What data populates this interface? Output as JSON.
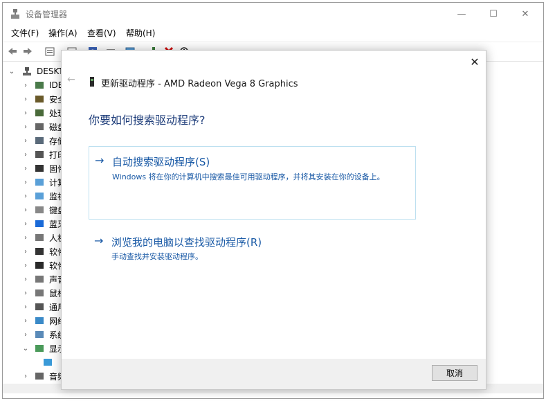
{
  "window": {
    "title": "设备管理器",
    "controls": {
      "minimize": "—",
      "maximize": "☐",
      "close": "✕"
    }
  },
  "menu": [
    "文件(F)",
    "操作(A)",
    "查看(V)",
    "帮助(H)"
  ],
  "toolbar": [
    "back-icon",
    "forward-icon",
    "properties-icon",
    "view-icon",
    "help-icon",
    "toolbar-icon",
    "monitor-icon",
    "scan-icon",
    "uninstall-icon",
    "disable-icon"
  ],
  "tree": {
    "root": "DESKT",
    "items": [
      {
        "label": "IDE",
        "icon": "ide-icon"
      },
      {
        "label": "安全",
        "icon": "security-icon"
      },
      {
        "label": "处理",
        "icon": "processor-icon"
      },
      {
        "label": "磁盘",
        "icon": "disk-icon"
      },
      {
        "label": "存储",
        "icon": "storage-icon"
      },
      {
        "label": "打印",
        "icon": "printer-icon"
      },
      {
        "label": "固件",
        "icon": "firmware-icon"
      },
      {
        "label": "计算",
        "icon": "computer-icon"
      },
      {
        "label": "监视",
        "icon": "monitor-icon"
      },
      {
        "label": "键盘",
        "icon": "keyboard-icon"
      },
      {
        "label": "蓝牙",
        "icon": "bluetooth-icon"
      },
      {
        "label": "人机",
        "icon": "hid-icon"
      },
      {
        "label": "软件",
        "icon": "software-icon"
      },
      {
        "label": "软件",
        "icon": "software-component-icon"
      },
      {
        "label": "声音",
        "icon": "audio-icon"
      },
      {
        "label": "鼠标",
        "icon": "mouse-icon"
      },
      {
        "label": "通用",
        "icon": "usb-icon"
      },
      {
        "label": "网络",
        "icon": "network-icon"
      },
      {
        "label": "系统",
        "icon": "system-icon"
      },
      {
        "label": "显示",
        "icon": "display-icon",
        "expanded": true
      },
      {
        "label": "",
        "icon": "display-adapter-icon",
        "child": true
      },
      {
        "label": "音频",
        "icon": "audio-io-icon"
      }
    ]
  },
  "dialog": {
    "close": "✕",
    "back": "←",
    "title": "更新驱动程序 - AMD Radeon Vega 8 Graphics",
    "question": "你要如何搜索驱动程序?",
    "options": [
      {
        "arrow": "→",
        "title": "自动搜索驱动程序(S)",
        "description": "Windows 将在你的计算机中搜索最佳可用驱动程序，并将其安装在你的设备上。"
      },
      {
        "arrow": "→",
        "title": "浏览我的电脑以查找驱动程序(R)",
        "description": "手动查找并安装驱动程序。"
      }
    ],
    "cancel_label": "取消"
  },
  "colors": {
    "link_blue": "#1a5aa6",
    "question_blue": "#1e3d7a",
    "option_border": "#bde0f0"
  }
}
